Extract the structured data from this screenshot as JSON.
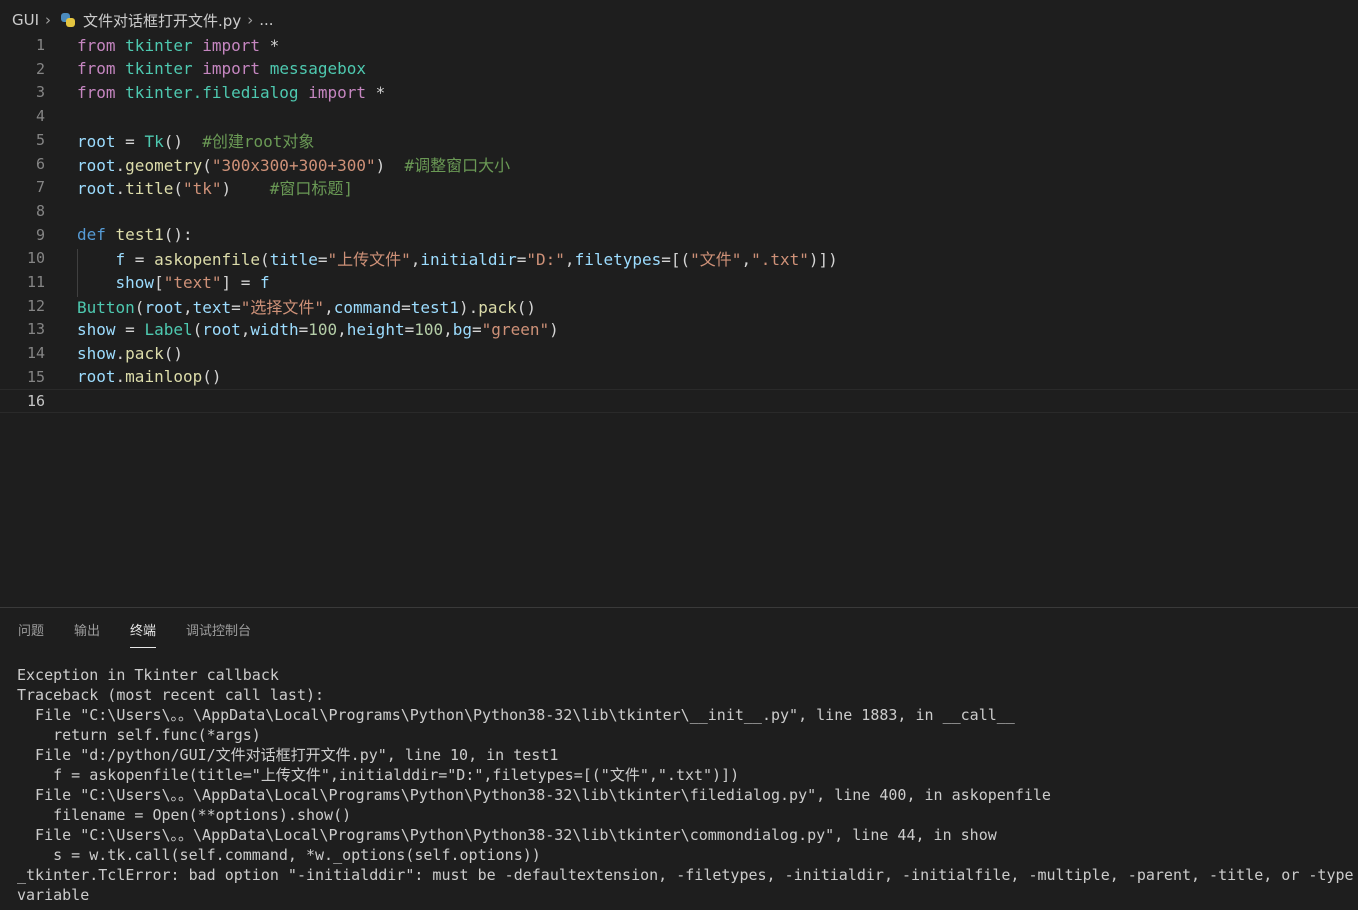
{
  "breadcrumb": {
    "folder": "GUI",
    "file": "文件对话框打开文件.py",
    "more": "..."
  },
  "editor": {
    "line_numbers": [
      "1",
      "2",
      "3",
      "4",
      "5",
      "6",
      "7",
      "8",
      "9",
      "10",
      "11",
      "12",
      "13",
      "14",
      "15",
      "16"
    ],
    "lines": [
      [
        [
          "kw",
          "from"
        ],
        [
          "pun",
          " "
        ],
        [
          "mod",
          "tkinter"
        ],
        [
          "pun",
          " "
        ],
        [
          "kw",
          "import"
        ],
        [
          "pun",
          " *"
        ]
      ],
      [
        [
          "kw",
          "from"
        ],
        [
          "pun",
          " "
        ],
        [
          "mod",
          "tkinter"
        ],
        [
          "pun",
          " "
        ],
        [
          "kw",
          "import"
        ],
        [
          "pun",
          " "
        ],
        [
          "mod",
          "messagebox"
        ]
      ],
      [
        [
          "kw",
          "from"
        ],
        [
          "pun",
          " "
        ],
        [
          "mod",
          "tkinter.filedialog"
        ],
        [
          "pun",
          " "
        ],
        [
          "kw",
          "import"
        ],
        [
          "pun",
          " *"
        ]
      ],
      [],
      [
        [
          "var",
          "root"
        ],
        [
          "pun",
          " = "
        ],
        [
          "mod",
          "Tk"
        ],
        [
          "pun",
          "()  "
        ],
        [
          "cmt",
          "#创建root对象"
        ]
      ],
      [
        [
          "var",
          "root"
        ],
        [
          "pun",
          "."
        ],
        [
          "fn",
          "geometry"
        ],
        [
          "pun",
          "("
        ],
        [
          "str",
          "\"300x300+300+300\""
        ],
        [
          "pun",
          ")  "
        ],
        [
          "cmt",
          "#调整窗口大小"
        ]
      ],
      [
        [
          "var",
          "root"
        ],
        [
          "pun",
          "."
        ],
        [
          "fn",
          "title"
        ],
        [
          "pun",
          "("
        ],
        [
          "str",
          "\"tk\""
        ],
        [
          "pun",
          ")    "
        ],
        [
          "cmt",
          "#窗口标题]"
        ]
      ],
      [],
      [
        [
          "def",
          "def"
        ],
        [
          "pun",
          " "
        ],
        [
          "fn",
          "test1"
        ],
        [
          "pun",
          "():"
        ]
      ],
      [
        [
          "pun",
          "    "
        ],
        [
          "var",
          "f"
        ],
        [
          "pun",
          " = "
        ],
        [
          "fn",
          "askopenfile"
        ],
        [
          "pun",
          "("
        ],
        [
          "var",
          "title"
        ],
        [
          "pun",
          "="
        ],
        [
          "str",
          "\"上传文件\""
        ],
        [
          "pun",
          ","
        ],
        [
          "var",
          "initialdir"
        ],
        [
          "pun",
          "="
        ],
        [
          "str",
          "\"D:\""
        ],
        [
          "pun",
          ","
        ],
        [
          "var",
          "filetypes"
        ],
        [
          "pun",
          "=[("
        ],
        [
          "str",
          "\"文件\""
        ],
        [
          "pun",
          ","
        ],
        [
          "str",
          "\".txt\""
        ],
        [
          "pun",
          ")])"
        ]
      ],
      [
        [
          "pun",
          "    "
        ],
        [
          "var",
          "show"
        ],
        [
          "pun",
          "["
        ],
        [
          "str",
          "\"text\""
        ],
        [
          "pun",
          "] = "
        ],
        [
          "var",
          "f"
        ]
      ],
      [
        [
          "mod",
          "Button"
        ],
        [
          "pun",
          "("
        ],
        [
          "var",
          "root"
        ],
        [
          "pun",
          ","
        ],
        [
          "var",
          "text"
        ],
        [
          "pun",
          "="
        ],
        [
          "str",
          "\"选择文件\""
        ],
        [
          "pun",
          ","
        ],
        [
          "var",
          "command"
        ],
        [
          "pun",
          "="
        ],
        [
          "var",
          "test1"
        ],
        [
          "pun",
          ")."
        ],
        [
          "fn",
          "pack"
        ],
        [
          "pun",
          "()"
        ]
      ],
      [
        [
          "var",
          "show"
        ],
        [
          "pun",
          " = "
        ],
        [
          "mod",
          "Label"
        ],
        [
          "pun",
          "("
        ],
        [
          "var",
          "root"
        ],
        [
          "pun",
          ","
        ],
        [
          "var",
          "width"
        ],
        [
          "pun",
          "="
        ],
        [
          "num",
          "100"
        ],
        [
          "pun",
          ","
        ],
        [
          "var",
          "height"
        ],
        [
          "pun",
          "="
        ],
        [
          "num",
          "100"
        ],
        [
          "pun",
          ","
        ],
        [
          "var",
          "bg"
        ],
        [
          "pun",
          "="
        ],
        [
          "str",
          "\"green\""
        ],
        [
          "pun",
          ")"
        ]
      ],
      [
        [
          "var",
          "show"
        ],
        [
          "pun",
          "."
        ],
        [
          "fn",
          "pack"
        ],
        [
          "pun",
          "()"
        ]
      ],
      [
        [
          "var",
          "root"
        ],
        [
          "pun",
          "."
        ],
        [
          "fn",
          "mainloop"
        ],
        [
          "pun",
          "()"
        ]
      ],
      []
    ]
  },
  "panel": {
    "tabs": [
      {
        "label": "问题",
        "active": false
      },
      {
        "label": "输出",
        "active": false
      },
      {
        "label": "终端",
        "active": true
      },
      {
        "label": "调试控制台",
        "active": false
      }
    ],
    "terminal_lines": [
      "Exception in Tkinter callback",
      "Traceback (most recent call last):",
      "  File \"C:\\Users\\。。\\AppData\\Local\\Programs\\Python\\Python38-32\\lib\\tkinter\\__init__.py\", line 1883, in __call__",
      "    return self.func(*args)",
      "  File \"d:/python/GUI/文件对话框打开文件.py\", line 10, in test1",
      "    f = askopenfile(title=\"上传文件\",initialddir=\"D:\",filetypes=[(\"文件\",\".txt\")])",
      "  File \"C:\\Users\\。。\\AppData\\Local\\Programs\\Python\\Python38-32\\lib\\tkinter\\filedialog.py\", line 400, in askopenfile",
      "    filename = Open(**options).show()",
      "  File \"C:\\Users\\。。\\AppData\\Local\\Programs\\Python\\Python38-32\\lib\\tkinter\\commondialog.py\", line 44, in show",
      "    s = w.tk.call(self.command, *w._options(self.options))",
      "_tkinter.TclError: bad option \"-initialddir\": must be -defaultextension, -filetypes, -initialdir, -initialfile, -multiple, -parent, -title, or -type",
      "variable"
    ]
  }
}
